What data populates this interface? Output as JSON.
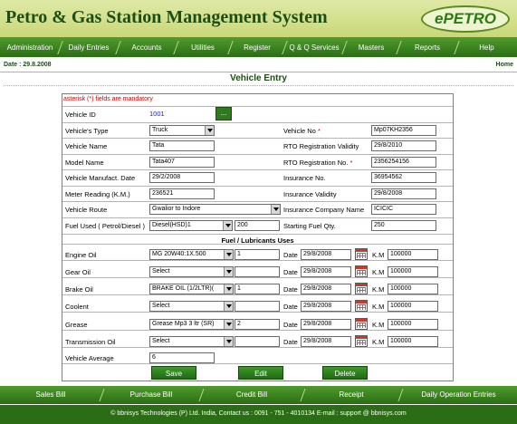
{
  "header": {
    "title": "Petro & Gas Station Management System",
    "logo": "ePETRO"
  },
  "nav": [
    "Administration",
    "Daily Entries",
    "Accounts",
    "Utilities",
    "Register",
    "Q & Q Services",
    "Masters",
    "Reports",
    "Help"
  ],
  "date_text": "Date : 29.8.2008",
  "home_label": "Home",
  "page_title": "Vehicle Entry",
  "mandatory_note": "asterisk (*) fields are mandatory",
  "form": {
    "vehicle_id": {
      "label": "Vehicle ID",
      "value": "1001",
      "lookup": "..."
    },
    "vehicle_type": {
      "label": "Vehicle's Type",
      "value": "Truck"
    },
    "vehicle_no": {
      "label": "Vehicle No",
      "value": "Mp07KH2356"
    },
    "vehicle_name": {
      "label": "Vehicle Name",
      "value": "Tata"
    },
    "rto_validity": {
      "label": "RTO Registration Validity",
      "value": "29/8/2010"
    },
    "model_name": {
      "label": "Model Name",
      "value": "Tata407"
    },
    "rto_no": {
      "label": "RTO Registration No.",
      "value": "2356254156"
    },
    "manufact_date": {
      "label": "Vehicle Manufact. Date",
      "value": "29/2/2008"
    },
    "insurance_no": {
      "label": "Insurance No.",
      "value": "36954562"
    },
    "meter_reading": {
      "label": "Meter Reading (K.M.)",
      "value": "236521"
    },
    "insurance_validity": {
      "label": "Insurance Validity",
      "value": "29/8/2008"
    },
    "vehicle_route": {
      "label": "Vehicle Route",
      "value": "Gwalior to Indore"
    },
    "insurance_company": {
      "label": "Insurance Company Name",
      "value": "ICICIC"
    },
    "fuel_used": {
      "label": "Fuel Used ( Petrol/Diesel )",
      "value": "Diesel(HSD)1",
      "qty": "200"
    },
    "starting_fuel": {
      "label": "Starting Fuel Qty.",
      "value": "250"
    }
  },
  "lubricants": {
    "heading": "Fuel / Lubricants Uses",
    "date_label": "Date",
    "km_label": "K.M",
    "rows": [
      {
        "label": "Engine Oil",
        "product": "MG 20W40:1X.500",
        "qty": "1",
        "date": "29/8/2008",
        "km": "100000"
      },
      {
        "label": "Gear Oil",
        "product": "Select",
        "qty": "",
        "date": "29/8/2008",
        "km": "100000"
      },
      {
        "label": "Brake Oil",
        "product": "BRAKE OIL (1/2LTR)(",
        "qty": "1",
        "date": "29/8/2008",
        "km": "100000"
      },
      {
        "label": "Coolent",
        "product": "Select",
        "qty": "",
        "date": "29/8/2008",
        "km": "100000"
      },
      {
        "label": "Grease",
        "product": "Grease Mp3 3 ltr (SR)",
        "qty": "2",
        "date": "29/8/2008",
        "km": "100000"
      },
      {
        "label": "Transmission Oil",
        "product": "Select",
        "qty": "",
        "date": "29/8/2008",
        "km": "100000"
      }
    ]
  },
  "vehicle_average": {
    "label": "Vehicle Average",
    "value": "6"
  },
  "buttons": {
    "save": "Save",
    "edit": "Edit",
    "delete": "Delete"
  },
  "footer_nav": [
    "Sales Bill",
    "Purchase Bill",
    "Credit Bill",
    "Receipt",
    "Daily Operation Entries"
  ],
  "copyright": "© bbnisys Technologies (P) Ltd. India, Contact us : 0091 - 751 - 4010134 E-mail : support @ bbnisys.com",
  "colors": {
    "primary_green": "#2a6d14",
    "header_bg": "#c8d878",
    "required": "#d00000"
  }
}
